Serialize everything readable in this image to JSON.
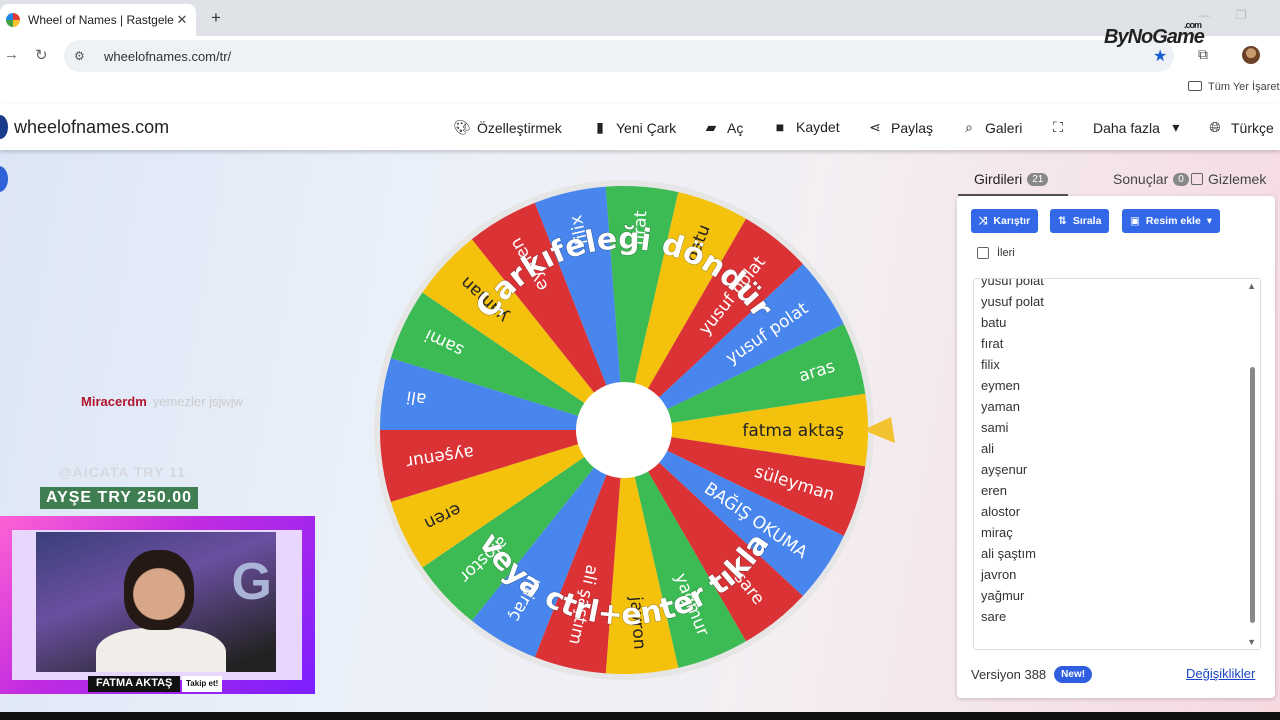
{
  "browser": {
    "tab_title": "Wheel of Names | Rastgele ad s",
    "new_tab": "+",
    "close": "✕",
    "url": "wheelofnames.com/tr/",
    "overlay_brand": "ByNoGame",
    "overlay_brand_suffix": ".com",
    "bookmarks_label": "Tüm Yer İşaretle"
  },
  "site": {
    "title": "wheelofnames.com",
    "menu": [
      {
        "label": "Özelleştirmek",
        "icon": "palette-icon"
      },
      {
        "label": "Yeni Çark",
        "icon": "file-icon"
      },
      {
        "label": "Aç",
        "icon": "folder-open-icon"
      },
      {
        "label": "Kaydet",
        "icon": "save-icon"
      },
      {
        "label": "Paylaş",
        "icon": "share-icon"
      },
      {
        "label": "Galeri",
        "icon": "search-icon"
      },
      {
        "label": "",
        "icon": "fullscreen-icon"
      },
      {
        "label": "Daha fazla",
        "icon": "caret-down-icon"
      },
      {
        "label": "Türkçe",
        "icon": "globe-icon"
      }
    ]
  },
  "stream": {
    "chat_user": "Miracerdm",
    "chat_message": "yemezler jsjwjw",
    "alert_ghost": "@AICATA TRY 11",
    "donation": "AYŞE TRY 250.00",
    "streamer_name": "FATMA AKTAŞ",
    "follow_label": "Takip et!",
    "cam_bg_letter": "G"
  },
  "wheel": {
    "slices": [
      {
        "label": "fatma aktaş",
        "color": "#f4c20d"
      },
      {
        "label": "süleyman",
        "color": "#db3236"
      },
      {
        "label": "BAĞIŞ OKUMA",
        "color": "#4885ed"
      },
      {
        "label": "sare",
        "color": "#db3236"
      },
      {
        "label": "yağmur",
        "color": "#3cba54"
      },
      {
        "label": "javron",
        "color": "#f4c20d"
      },
      {
        "label": "ali şaştım",
        "color": "#db3236"
      },
      {
        "label": "miraç",
        "color": "#4885ed"
      },
      {
        "label": "alostor",
        "color": "#3cba54"
      },
      {
        "label": "eren",
        "color": "#f4c20d"
      },
      {
        "label": "ayşenur",
        "color": "#db3236"
      },
      {
        "label": "ali",
        "color": "#4885ed"
      },
      {
        "label": "sami",
        "color": "#3cba54"
      },
      {
        "label": "yaman",
        "color": "#f4c20d"
      },
      {
        "label": "eymen",
        "color": "#db3236"
      },
      {
        "label": "filix",
        "color": "#4885ed"
      },
      {
        "label": "fırat",
        "color": "#3cba54"
      },
      {
        "label": "batu",
        "color": "#f4c20d"
      },
      {
        "label": "yusuf polat",
        "color": "#db3236"
      },
      {
        "label": "yusuf polat",
        "color": "#4885ed"
      },
      {
        "label": "aras",
        "color": "#3cba54"
      }
    ],
    "top_text": "Çarkıfeleği döndür",
    "bottom_text": "veya ctrl+enter tıkla",
    "pointer_color": "#f2c230",
    "center_color": "#ffffff"
  },
  "panel": {
    "tab_entries": "Girdileri",
    "entries_count": "21",
    "tab_results": "Sonuçlar",
    "results_count": "0",
    "hide_label": "Gizlemek",
    "shuffle": "Karıştır",
    "sort": "Sırala",
    "add_image": "Resim ekle",
    "advanced": "İleri",
    "entries": [
      "yusuf polat",
      "yusuf polat",
      "batu",
      "fırat",
      "filix",
      "eymen",
      "yaman",
      "sami",
      "ali",
      "ayşenur",
      "eren",
      "alostor",
      "miraç",
      "ali şaştım",
      "javron",
      "yağmur",
      "sare"
    ],
    "version": "Versiyon 388",
    "new_badge": "New!",
    "changes": "Değişiklikler"
  }
}
